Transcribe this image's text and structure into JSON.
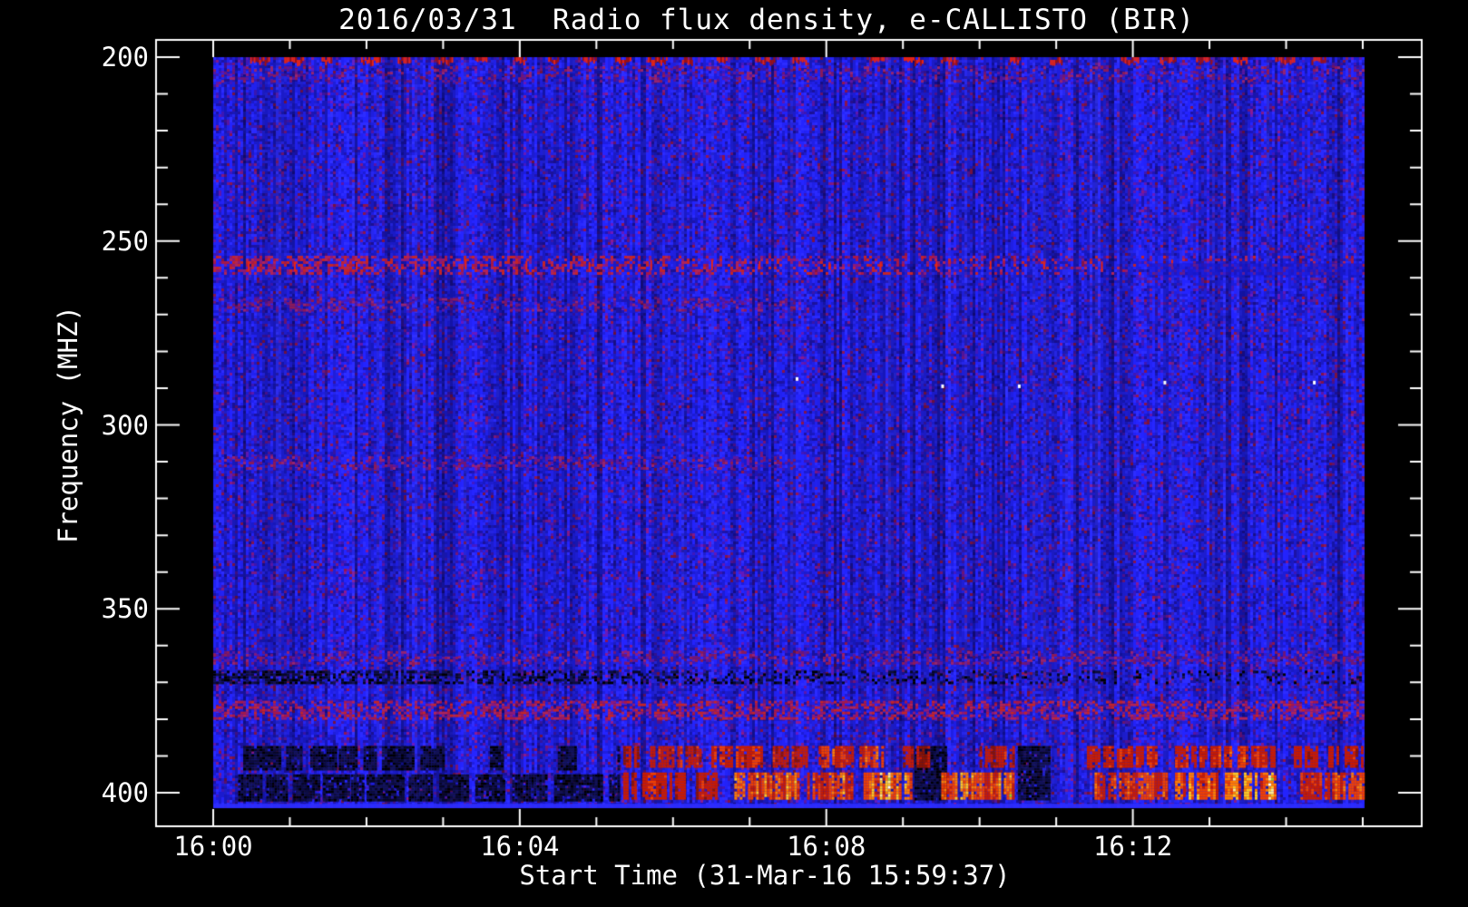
{
  "window": {
    "background": "#000000",
    "frame_color": "#ffffff",
    "text_color": "#ffffff"
  },
  "chart_data": {
    "type": "heatmap",
    "subtype": "radio-spectrogram",
    "title": "2016/03/31  Radio flux density, e-CALLISTO (BIR)",
    "xlabel": "Start Time (31-Mar-16 15:59:37)",
    "ylabel": "Frequency (MHZ)",
    "x_axis": {
      "unit": "time (UT)",
      "range_minutes": [
        0,
        15
      ],
      "major_ticks": [
        {
          "t": 0,
          "label": "16:00"
        },
        {
          "t": 4,
          "label": "16:04"
        },
        {
          "t": 8,
          "label": "16:08"
        },
        {
          "t": 12,
          "label": "16:12"
        }
      ],
      "minor_tick_interval_min": 1
    },
    "y_axis": {
      "unit": "MHz",
      "range": [
        200,
        404
      ],
      "direction": "increasing-downward",
      "major_ticks": [
        {
          "f": 200,
          "label": "200"
        },
        {
          "f": 250,
          "label": "250"
        },
        {
          "f": 300,
          "label": "300"
        },
        {
          "f": 350,
          "label": "350"
        },
        {
          "f": 400,
          "label": "400"
        }
      ],
      "minor_tick_interval": 10
    },
    "grid": false,
    "legend": "none",
    "colormap": {
      "background_blue": "#2121ec",
      "bright_blue": "#2a2aff",
      "mid_blue": "#1a1ac8",
      "deep_blue": "#1c12a0",
      "violet": "#3a16b0",
      "magenta": "#5a16a8",
      "purple_red": "#7a1880",
      "maroon": "#801448",
      "dash_red": "#e82414",
      "burst_red": "#c81c00",
      "burst_orange": "#ff7d00",
      "burst_yellow": "#ffc822",
      "burst_pale": "#ffeb90",
      "burst_white": "#ffffff",
      "burst_green": "#96d022",
      "black": "#000000",
      "bottom_edge_blue": "#2d2dff"
    },
    "background_noise": {
      "palette": [
        {
          "c": "#2121ec",
          "w": 0.4
        },
        {
          "c": "#2a2aff",
          "w": 0.14
        },
        {
          "c": "#1a1ac8",
          "w": 0.18
        },
        {
          "c": "#1c12a0",
          "w": 0.1
        },
        {
          "c": "#3a16b0",
          "w": 0.08
        },
        {
          "c": "#5a16a8",
          "w": 0.05
        },
        {
          "c": "#7a1880",
          "w": 0.03
        },
        {
          "c": "#801448",
          "w": 0.02
        }
      ],
      "dark_streak_prob": 0.17,
      "bright_streak_prob": 0.1
    },
    "band_palettes": {
      "faint_red": [
        "#6e1678",
        "#8c1a58",
        "#5a16a0",
        "#962470"
      ],
      "red_purple": [
        "#a81848",
        "#c42428",
        "#8c1a78",
        "#b02458"
      ],
      "dark": [
        "#000000",
        "#070726",
        "#0d0d3a",
        "#131350"
      ]
    },
    "features": [
      {
        "name": "top-edge-rfi",
        "kind": "speckle_row",
        "f": [
          200,
          201.8
        ],
        "t": [
          0,
          15
        ],
        "density": 0.8,
        "note": "dashed red interference along 200 MHz edge"
      },
      {
        "name": "band-204",
        "kind": "noise_band",
        "f": [
          202.5,
          206.5
        ],
        "t": [
          0,
          15
        ],
        "palette": "faint_red",
        "density": 0.22
      },
      {
        "name": "band-256",
        "kind": "noise_band",
        "f": [
          254,
          258.5
        ],
        "t": [
          0,
          15
        ],
        "palette": "red_purple",
        "density": 0.5,
        "fade": "right"
      },
      {
        "name": "band-256-dashes",
        "kind": "tick_dashes",
        "f": [
          255,
          257.5
        ],
        "t": [
          0.35,
          12.4
        ],
        "count": 17
      },
      {
        "name": "band-267",
        "kind": "noise_band",
        "f": [
          265.5,
          268.5
        ],
        "t": [
          0,
          7.6
        ],
        "palette": "faint_red",
        "density": 0.3
      },
      {
        "name": "band-258-right-smooth",
        "kind": "smooth_band",
        "f": [
          256,
          259.5
        ],
        "t": [
          12.2,
          15
        ],
        "color": "#1717d2",
        "alpha": 0.55
      },
      {
        "name": "band-310",
        "kind": "noise_band",
        "f": [
          308.5,
          311.5
        ],
        "t": [
          0,
          7.6
        ],
        "palette": "faint_red",
        "density": 0.32
      },
      {
        "name": "band-363",
        "kind": "noise_band",
        "f": [
          361.5,
          365
        ],
        "t": [
          0,
          15
        ],
        "palette": "faint_red",
        "density": 0.3
      },
      {
        "name": "band-368-dark-lane",
        "kind": "dark_lane",
        "f": [
          366.8,
          370
        ],
        "t": [
          0,
          15
        ],
        "density": 0.6,
        "fade": "right"
      },
      {
        "name": "band-377",
        "kind": "noise_band",
        "f": [
          375,
          380
        ],
        "t": [
          0,
          15
        ],
        "palette": "red_purple",
        "density": 0.42
      },
      {
        "name": "absorption-upper",
        "kind": "dark_blocks",
        "f": [
          387.3,
          393.3
        ],
        "t": [
          0,
          5.3
        ],
        "density": 0.78
      },
      {
        "name": "absorption-lower",
        "kind": "dark_blocks",
        "f": [
          395,
          402
        ],
        "t": [
          0,
          5.3
        ],
        "density": 0.85
      },
      {
        "name": "burst-gap-1",
        "kind": "dark_blocks",
        "f": [
          387.3,
          402
        ],
        "t": [
          9.15,
          9.55
        ],
        "density": 0.55
      },
      {
        "name": "burst-gap-2",
        "kind": "dark_blocks",
        "f": [
          387.3,
          402
        ],
        "t": [
          10.5,
          11.4
        ],
        "density": 0.6
      },
      {
        "name": "burst-gap-3",
        "kind": "dark_blocks",
        "f": [
          388,
          402
        ],
        "t": [
          13.9,
          14.15
        ],
        "density": 0.5
      },
      {
        "name": "burst-row-upper",
        "kind": "burst_row",
        "f": [
          387.3,
          393
        ],
        "segments": [
          [
            5.35,
            5.55,
            0.4
          ],
          [
            5.7,
            6.35,
            0.55
          ],
          [
            6.5,
            7.15,
            0.6
          ],
          [
            7.3,
            7.75,
            0.55
          ],
          [
            7.9,
            8.75,
            0.7
          ],
          [
            9.0,
            9.35,
            0.45
          ],
          [
            10.0,
            10.45,
            0.5
          ],
          [
            11.4,
            12.35,
            0.6
          ],
          [
            12.55,
            13.85,
            0.65
          ],
          [
            14.1,
            14.4,
            0.5
          ],
          [
            14.55,
            15.0,
            0.55
          ]
        ]
      },
      {
        "name": "burst-row-lower",
        "kind": "burst_row",
        "f": [
          394.5,
          401.5
        ],
        "segments": [
          [
            5.35,
            5.5,
            0.45
          ],
          [
            5.6,
            6.15,
            0.6
          ],
          [
            6.3,
            6.55,
            0.5
          ],
          [
            6.8,
            7.65,
            0.85
          ],
          [
            7.75,
            8.35,
            0.8
          ],
          [
            8.45,
            9.15,
            1.0
          ],
          [
            9.5,
            10.45,
            0.9
          ],
          [
            11.5,
            12.45,
            0.7
          ],
          [
            12.55,
            13.15,
            0.85
          ],
          [
            13.2,
            13.85,
            1.0
          ],
          [
            14.15,
            14.55,
            0.6
          ],
          [
            14.6,
            15.0,
            0.75
          ]
        ]
      },
      {
        "name": "bottom-edge",
        "kind": "smooth_band",
        "f": [
          403,
          404.2
        ],
        "t": [
          0,
          15
        ],
        "color": "#2d2dff",
        "alpha": 0.9
      },
      {
        "name": "white-dots",
        "kind": "dots",
        "points": [
          [
            7.6,
            287
          ],
          [
            9.5,
            289
          ],
          [
            10.5,
            289
          ],
          [
            12.4,
            288
          ],
          [
            14.35,
            288
          ]
        ],
        "color": "#ffffff"
      }
    ]
  }
}
